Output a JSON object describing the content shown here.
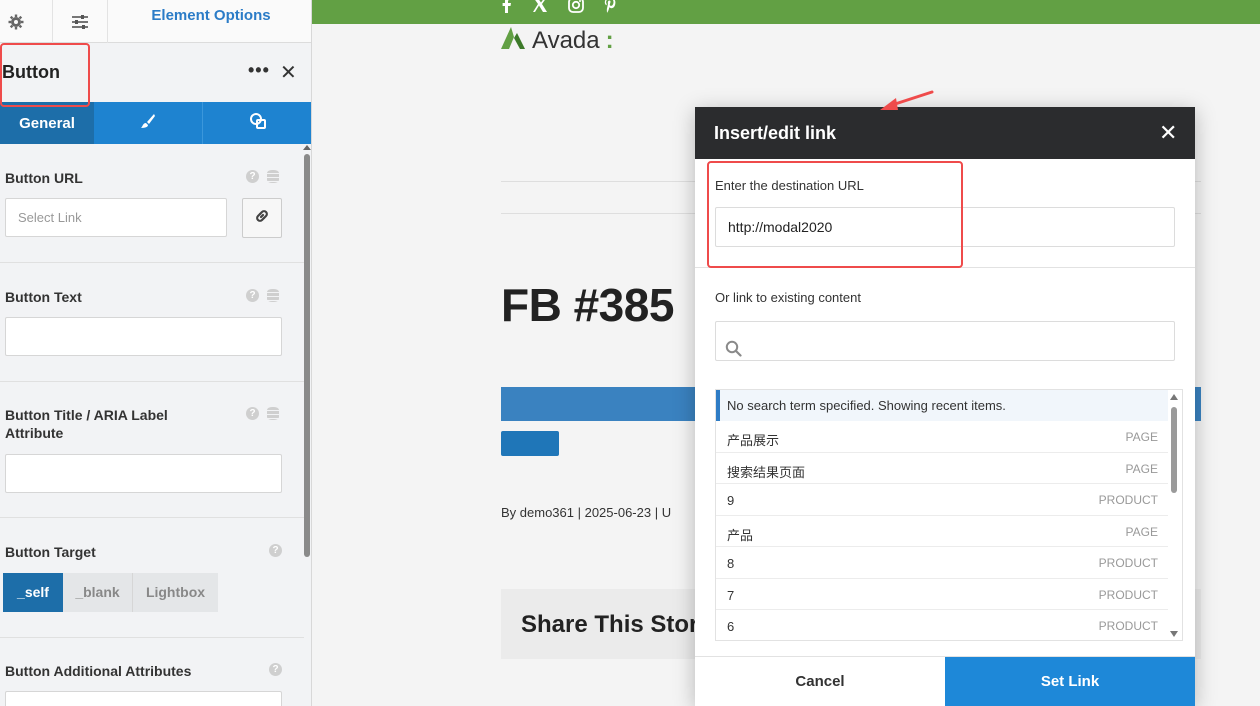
{
  "sidebar": {
    "panel_title": "Element Options",
    "element_name": "Button",
    "more_label": "•••",
    "close_label": "✕",
    "tabs": [
      {
        "label": "General"
      },
      {
        "icon": "brush-icon"
      },
      {
        "icon": "extras-icon"
      }
    ],
    "fields": {
      "url_label": "Button URL",
      "url_placeholder": "Select Link",
      "text_label": "Button Text",
      "title_label": "Button Title / ARIA Label Attribute",
      "target_label": "Button Target",
      "target_options": [
        "_self",
        "_blank",
        "Lightbox"
      ],
      "attrs_label": "Button Additional Attributes"
    }
  },
  "preview": {
    "logo_text": "Avada",
    "logo_colon": ":",
    "headline": "FB #385",
    "meta": "By demo361 | 2025-06-23 | U",
    "share": "Share This Story"
  },
  "modal": {
    "title": "Insert/edit link",
    "close_label": "✕",
    "url_label": "Enter the destination URL",
    "url_value": "http://modal2020",
    "existing_label": "Or link to existing content",
    "notice": "No search term specified. Showing recent items.",
    "results": [
      {
        "name": "产品展示",
        "kind": "PAGE"
      },
      {
        "name": "搜索结果页面",
        "kind": "PAGE"
      },
      {
        "name": "9",
        "kind": "PRODUCT"
      },
      {
        "name": "产品",
        "kind": "PAGE"
      },
      {
        "name": "8",
        "kind": "PRODUCT"
      },
      {
        "name": "7",
        "kind": "PRODUCT"
      },
      {
        "name": "6",
        "kind": "PRODUCT"
      }
    ],
    "cancel_label": "Cancel",
    "set_label": "Set Link"
  },
  "colors": {
    "accent_blue": "#1e88d8",
    "brand_green": "#62a044",
    "highlight_red": "#ef4b4b",
    "modal_header": "#2b2c2e"
  }
}
